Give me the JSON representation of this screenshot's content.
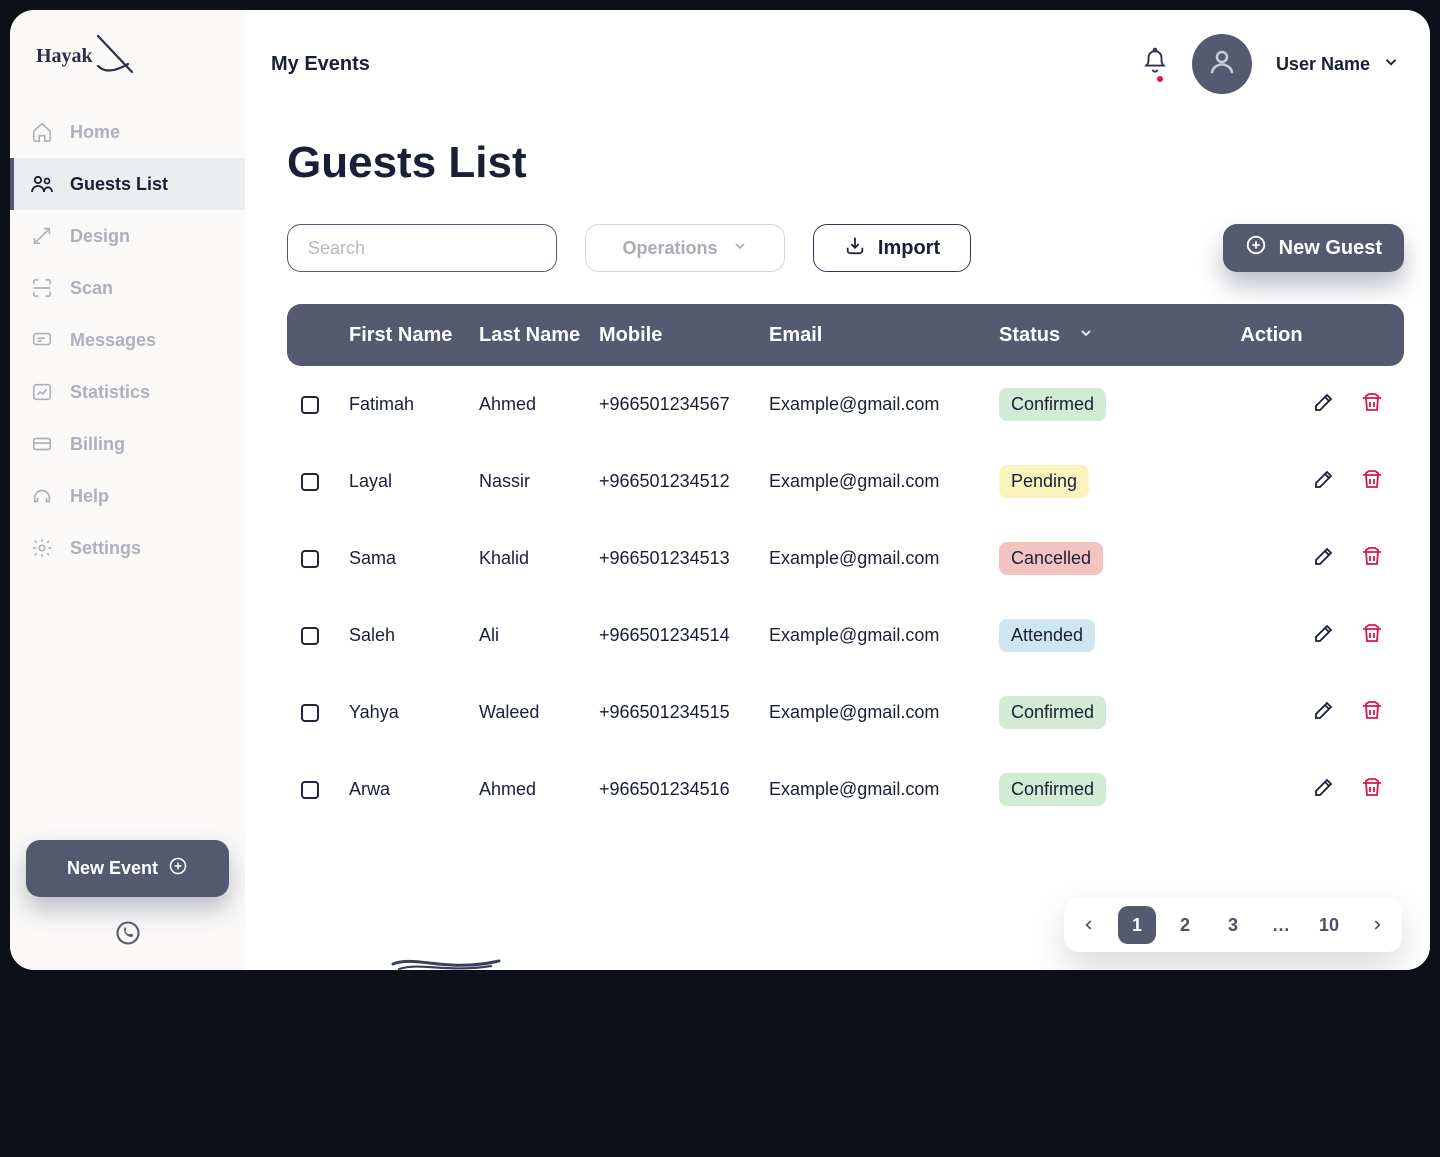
{
  "brand": "Hayak",
  "header": {
    "title": "My Events",
    "user_name": "User Name"
  },
  "sidebar": {
    "items": [
      {
        "label": "Home"
      },
      {
        "label": "Guests List"
      },
      {
        "label": "Design"
      },
      {
        "label": "Scan"
      },
      {
        "label": "Messages"
      },
      {
        "label": "Statistics"
      },
      {
        "label": "Billing"
      },
      {
        "label": "Help"
      },
      {
        "label": "Settings"
      }
    ],
    "new_event_label": "New Event"
  },
  "page": {
    "title": "Guests List"
  },
  "toolbar": {
    "search_placeholder": "Search",
    "operations_label": "Operations",
    "import_label": "Import",
    "new_guest_label": "New Guest"
  },
  "table": {
    "headers": {
      "first_name": "First Name",
      "last_name": "Last Name",
      "mobile": "Mobile",
      "email": "Email",
      "status": "Status",
      "action": "Action"
    },
    "rows": [
      {
        "first": "Fatimah",
        "last": "Ahmed",
        "mobile": "+966501234567",
        "email": "Example@gmail.com",
        "status": "Confirmed",
        "status_key": "confirmed"
      },
      {
        "first": "Layal",
        "last": "Nassir",
        "mobile": "+966501234512",
        "email": "Example@gmail.com",
        "status": "Pending",
        "status_key": "pending"
      },
      {
        "first": "Sama",
        "last": "Khalid",
        "mobile": "+966501234513",
        "email": "Example@gmail.com",
        "status": "Cancelled",
        "status_key": "cancelled"
      },
      {
        "first": "Saleh",
        "last": "Ali",
        "mobile": "+966501234514",
        "email": "Example@gmail.com",
        "status": "Attended",
        "status_key": "attended"
      },
      {
        "first": "Yahya",
        "last": "Waleed",
        "mobile": "+966501234515",
        "email": "Example@gmail.com",
        "status": "Confirmed",
        "status_key": "confirmed"
      },
      {
        "first": "Arwa",
        "last": "Ahmed",
        "mobile": "+966501234516",
        "email": "Example@gmail.com",
        "status": "Confirmed",
        "status_key": "confirmed"
      }
    ]
  },
  "pagination": {
    "pages": [
      "1",
      "2",
      "3",
      "…",
      "10"
    ],
    "active_index": 0
  },
  "colors": {
    "dark_navy": "#1a1e37",
    "muted_navy": "#565a71",
    "accent_red": "#dc1547"
  }
}
